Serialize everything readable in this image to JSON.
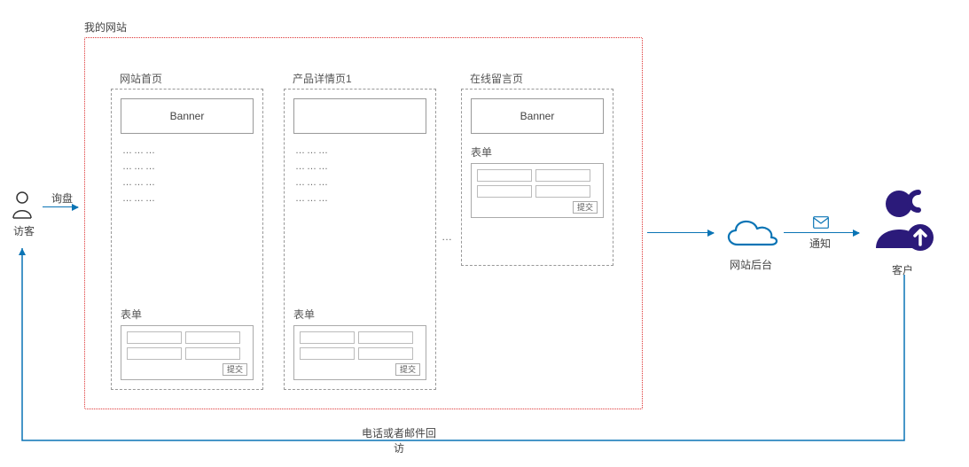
{
  "visitor_label": "访客",
  "inquiry_label": "询盘",
  "site_title": "我的网站",
  "pages": {
    "home": {
      "title": "网站首页",
      "banner": "Banner",
      "form_title": "表单",
      "submit": "提交"
    },
    "detail": {
      "title": "产品详情页1",
      "form_title": "表单",
      "submit": "提交"
    },
    "guestbook": {
      "title": "在线留言页",
      "banner": "Banner",
      "form_title": "表单",
      "submit": "提交"
    }
  },
  "between_pages_ellipsis": "…",
  "dots_line": "………",
  "cloud_label": "网站后台",
  "notify_label": "通知",
  "customer_label": "客户",
  "return_label_line1": "电话或者邮件回",
  "return_label_line2": "访",
  "colors": {
    "accent": "#0a74b5",
    "dotted_border": "#d33",
    "customer": "#2b1a7a"
  }
}
